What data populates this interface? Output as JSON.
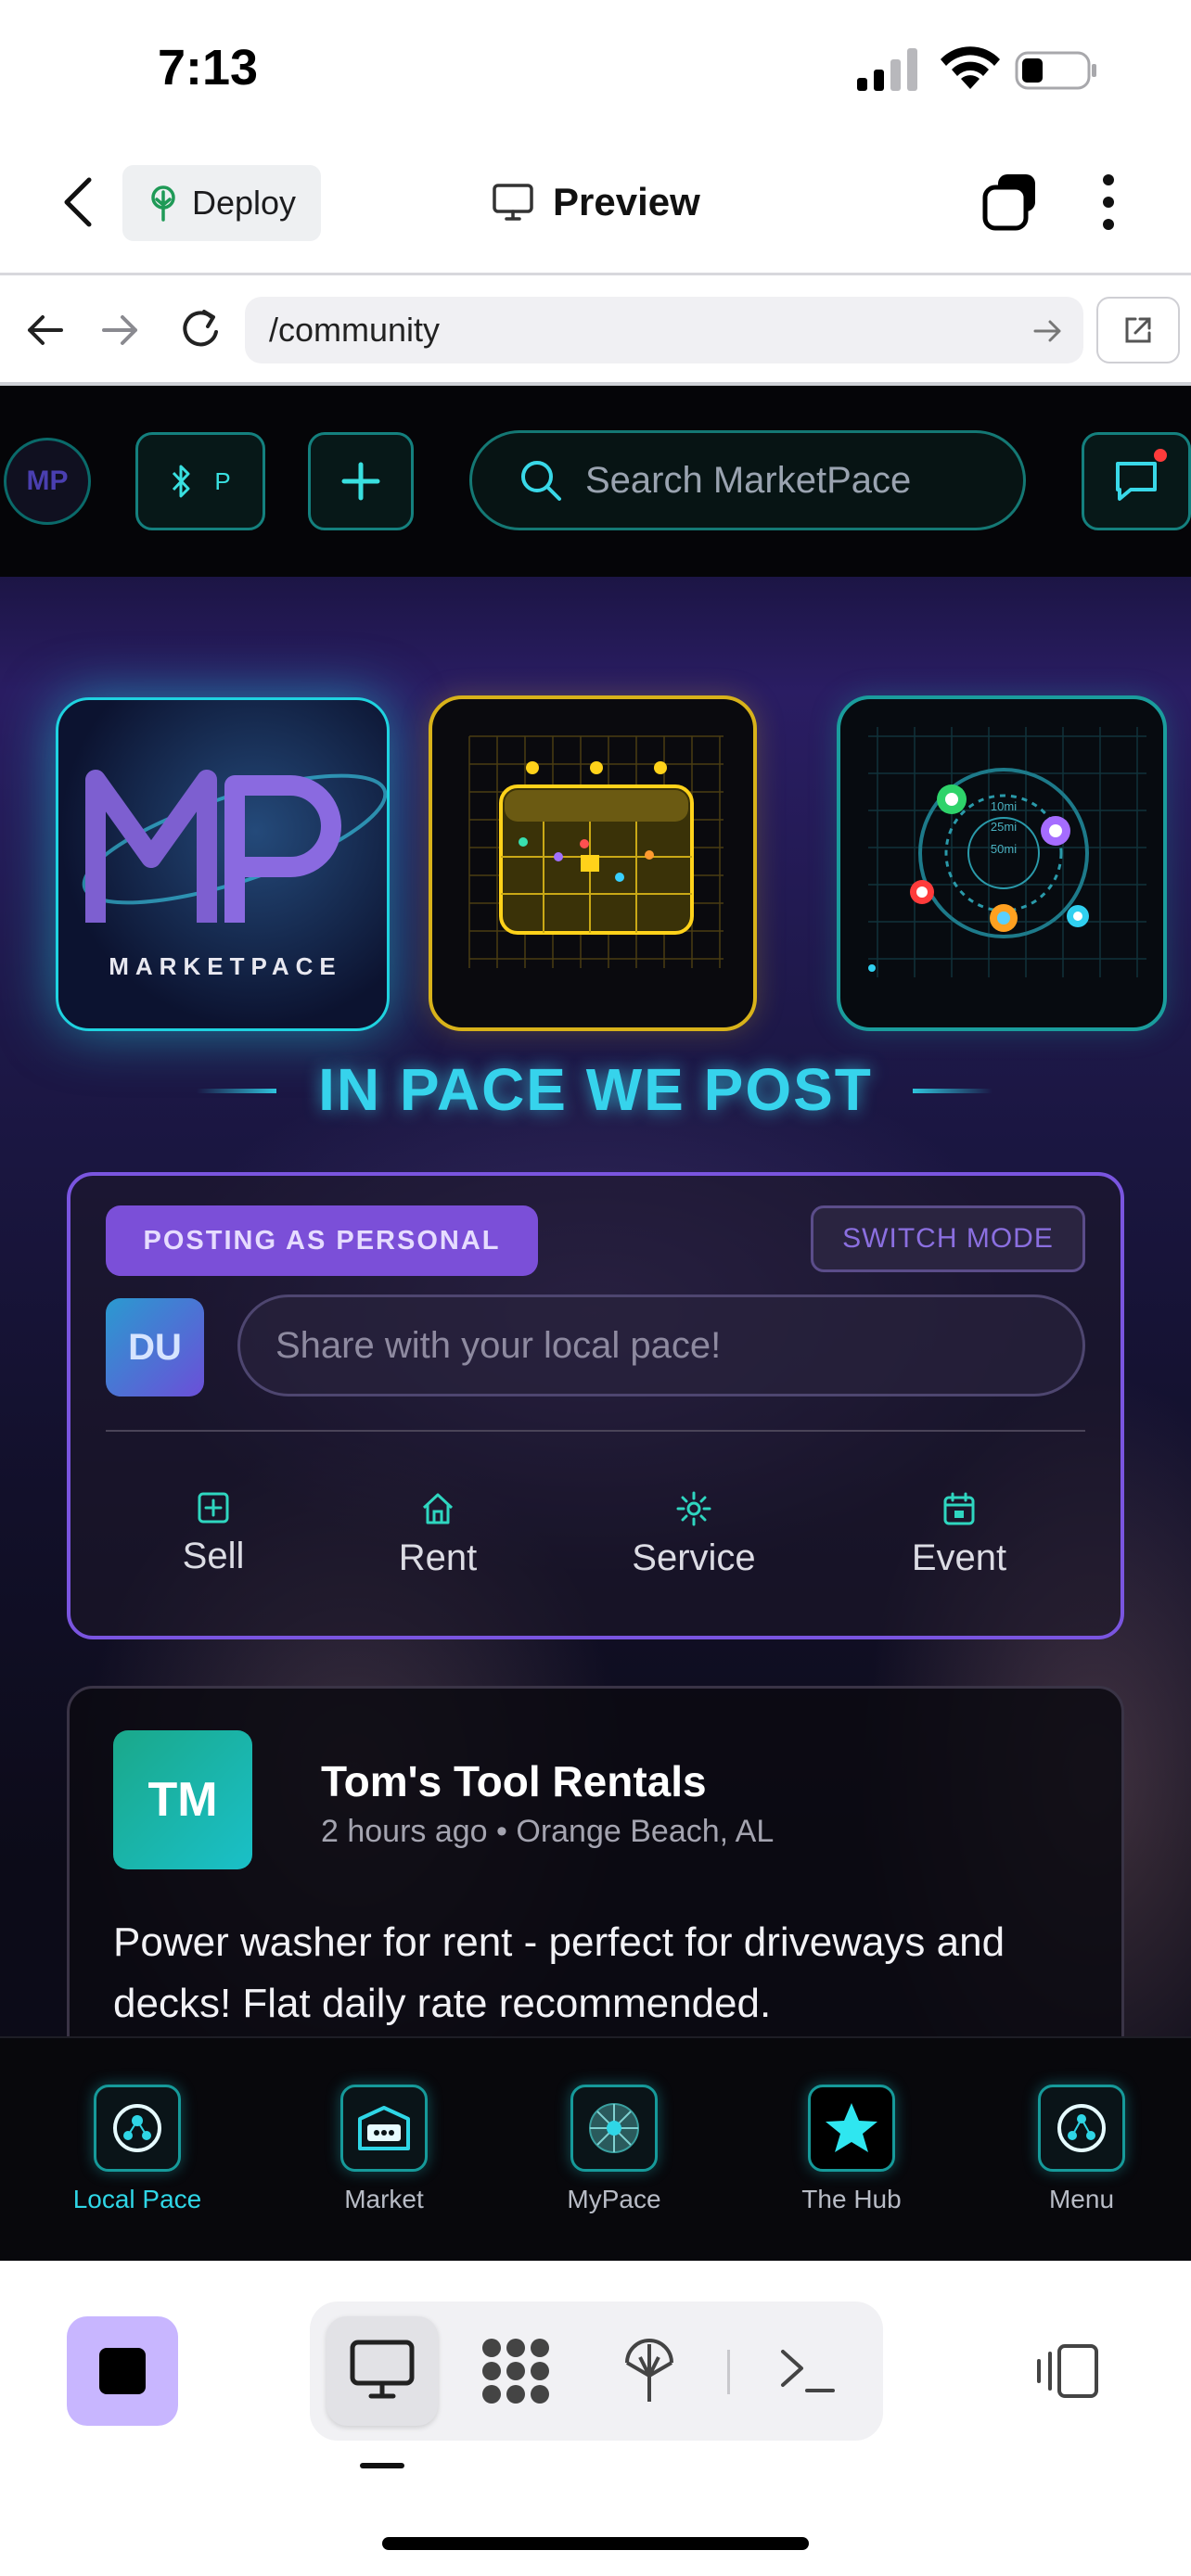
{
  "status_bar": {
    "time": "7:13"
  },
  "app_bar": {
    "deploy_label": "Deploy",
    "preview_label": "Preview"
  },
  "browser": {
    "url": "/community"
  },
  "site_header": {
    "avatar_text": "MP",
    "bt_label": "P",
    "search_placeholder": "Search MarketPace"
  },
  "hero": {
    "logo_word": "MARKETPACE",
    "logo_letters": "MP",
    "tagline": "IN PACE WE POST",
    "map_rings": [
      "10mi",
      "25mi",
      "50mi"
    ]
  },
  "composer": {
    "posting_badge": "POSTING AS PERSONAL",
    "switch_label": "SWITCH MODE",
    "avatar_initials": "DU",
    "placeholder": "Share with your local pace!",
    "actions": [
      {
        "label": "Sell",
        "icon": "plus-square-icon"
      },
      {
        "label": "Rent",
        "icon": "home-icon"
      },
      {
        "label": "Service",
        "icon": "sun-icon"
      },
      {
        "label": "Event",
        "icon": "calendar-icon"
      }
    ]
  },
  "post": {
    "avatar_initials": "TM",
    "author": "Tom's Tool Rentals",
    "meta": "2 hours ago • Orange Beach, AL",
    "body": "Power washer for rent - perfect for driveways and decks! Flat daily rate recommended."
  },
  "bottom_nav": {
    "items": [
      {
        "label": "Local Pace",
        "icon": "local-pace-icon",
        "active": true
      },
      {
        "label": "Market",
        "icon": "market-icon",
        "active": false
      },
      {
        "label": "MyPace",
        "icon": "mypace-icon",
        "active": false
      },
      {
        "label": "The Hub",
        "icon": "star-icon",
        "active": false
      },
      {
        "label": "Menu",
        "icon": "menu-icon",
        "active": false
      }
    ]
  },
  "colors": {
    "accent_cyan": "#36d3ec",
    "accent_purple": "#7b4fd8",
    "calendar_gold": "#d8b21a",
    "active_nav": "#2fd6e6"
  }
}
